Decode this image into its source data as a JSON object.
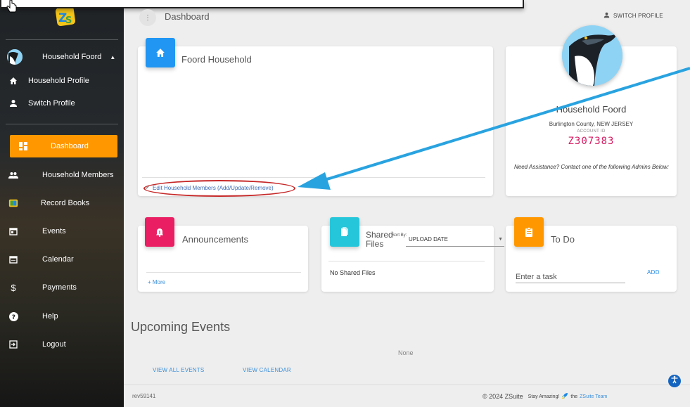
{
  "header": {
    "title": "Dashboard",
    "switch_profile": "SWITCH PROFILE"
  },
  "sidebar": {
    "user": {
      "name": "Household Foord"
    },
    "profile_links": [
      {
        "label": "Household Profile",
        "icon": "home-icon"
      },
      {
        "label": "Switch Profile",
        "icon": "person-icon"
      }
    ],
    "items": [
      {
        "label": "Dashboard",
        "icon": "dashboard-icon",
        "active": true
      },
      {
        "label": "Household Members",
        "icon": "people-icon"
      },
      {
        "label": "Record Books",
        "icon": "record-books-icon"
      },
      {
        "label": "Events",
        "icon": "events-icon"
      },
      {
        "label": "Calendar",
        "icon": "calendar-icon"
      },
      {
        "label": "Payments",
        "icon": "dollar-icon"
      },
      {
        "label": "Help",
        "icon": "help-icon"
      },
      {
        "label": "Logout",
        "icon": "logout-icon"
      }
    ]
  },
  "household_card": {
    "title": "Foord Household",
    "edit_link": "Edit Household Members (Add/Update/Remove)"
  },
  "profile_card": {
    "name": "Household Foord",
    "location": "Burlington County, NEW JERSEY",
    "account_label": "ACCOUNT ID",
    "account_id": "Z307383",
    "assistance": "Need Assistance? Contact one of the following Admins Below:"
  },
  "announcements": {
    "title": "Announcements",
    "more": "+ More"
  },
  "shared_files": {
    "title": "Shared Files",
    "sort_label": "Sort By:",
    "sort_value": "UPLOAD DATE",
    "empty": "No Shared Files"
  },
  "todo": {
    "title": "To Do",
    "placeholder": "Enter a task",
    "add": "ADD"
  },
  "upcoming": {
    "title": "Upcoming Events",
    "empty": "None",
    "view_all": "VIEW ALL EVENTS",
    "view_calendar": "VIEW CALENDAR"
  },
  "footer": {
    "rev": "rev59141",
    "copyright": "© 2024 ZSuite",
    "tagline_prefix": "Stay Amazing!",
    "tagline_the": "the",
    "team": "ZSuite Team"
  },
  "colors": {
    "accent_orange": "#ff9800",
    "blue": "#2196f3",
    "pink": "#e91e63",
    "teal": "#26c6da",
    "account_id": "#d81b60",
    "annotation_arrow": "#29a3e0",
    "annotation_oval": "#c62828"
  }
}
